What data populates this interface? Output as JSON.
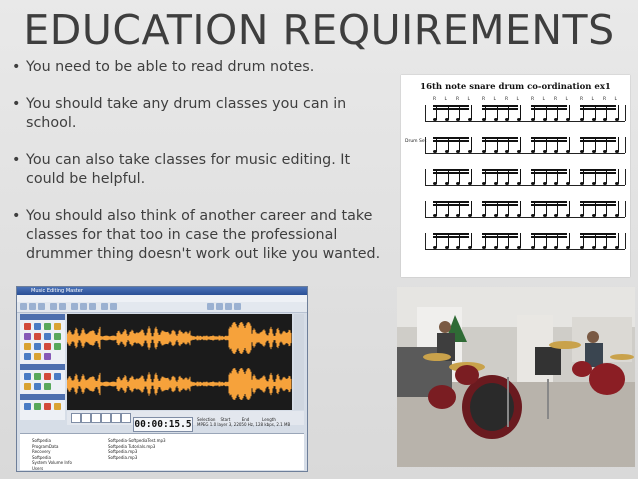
{
  "slide": {
    "title": "EDUCATION REQUIREMENTS",
    "bullets": [
      "You need to be able to read drum notes.",
      "You should take any drum classes you can in school.",
      "You can also take classes for music editing. It could be helpful.",
      "You should also think of another career and take classes for that too in case the professional drummer thing doesn't work out like you wanted."
    ]
  },
  "sheet_music": {
    "title": "16th note snare drum co-ordination ex1",
    "sticking": "R L R L",
    "kit_label": "Drum Set"
  },
  "audio_editor": {
    "window_title": "Music Editing Master",
    "menu": [
      "File",
      "Edit",
      "Operations",
      "View",
      "Tools",
      "Options",
      "Help"
    ],
    "panels": [
      "Operations",
      "Filters",
      "Tools"
    ],
    "time_display": "00:00:15.5",
    "file_info": "Selection    Start         End          Length\nMPEG 1.0 layer 3, 22050 Hz, 128 kbps, 2.1 MB",
    "folder_tree": [
      "Softpedia",
      "ProgramData",
      "Recovery",
      "Softpedia",
      "System Volume Info",
      "Users",
      "Windows"
    ],
    "files": [
      "Softpedia-SoftpediaTest.mp3",
      "Softpedia Tutorials.mp3",
      "Softpedia.mp3",
      "Softpedia.mp3"
    ],
    "waveform_color": "#f6a23b"
  },
  "photo": {
    "description_icon": "drum-kit-photo"
  }
}
